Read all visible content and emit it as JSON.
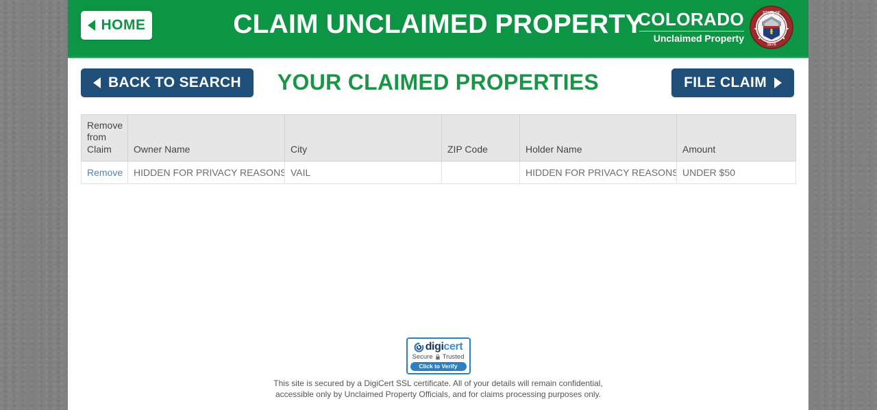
{
  "header": {
    "home_button": "HOME",
    "title": "CLAIM UNCLAIMED PROPERTY",
    "brand_name": "COLORADO",
    "brand_subtitle": "Unclaimed Property",
    "seal_top_text": "STATE OF COLORADO",
    "seal_year": "1876",
    "background_color": "#0d9444"
  },
  "actions": {
    "back_button": "BACK TO SEARCH",
    "page_heading": "YOUR CLAIMED PROPERTIES",
    "file_claim_button": "FILE CLAIM",
    "button_color": "#1f4e79",
    "heading_color": "#1a9547"
  },
  "table": {
    "columns": [
      "Remove from Claim",
      "Owner Name",
      "City",
      "ZIP Code",
      "Holder Name",
      "Amount"
    ],
    "rows": [
      {
        "remove": "Remove",
        "owner_name": "HIDDEN FOR PRIVACY REASONS",
        "city": "VAIL",
        "zip_code": "",
        "holder_name": "HIDDEN FOR PRIVACY REASONS",
        "amount": "UNDER $50"
      }
    ]
  },
  "footer": {
    "badge_brand_1": "digi",
    "badge_brand_2": "cert",
    "badge_secure": "Secure",
    "badge_trusted": "Trusted",
    "badge_verify": "Click to Verify",
    "note_line_1": "This site is secured by a DigiCert SSL certificate. All of your details will remain confidential,",
    "note_line_2": "accessible only by Unclaimed Property Officials, and for claims processing purposes only."
  }
}
